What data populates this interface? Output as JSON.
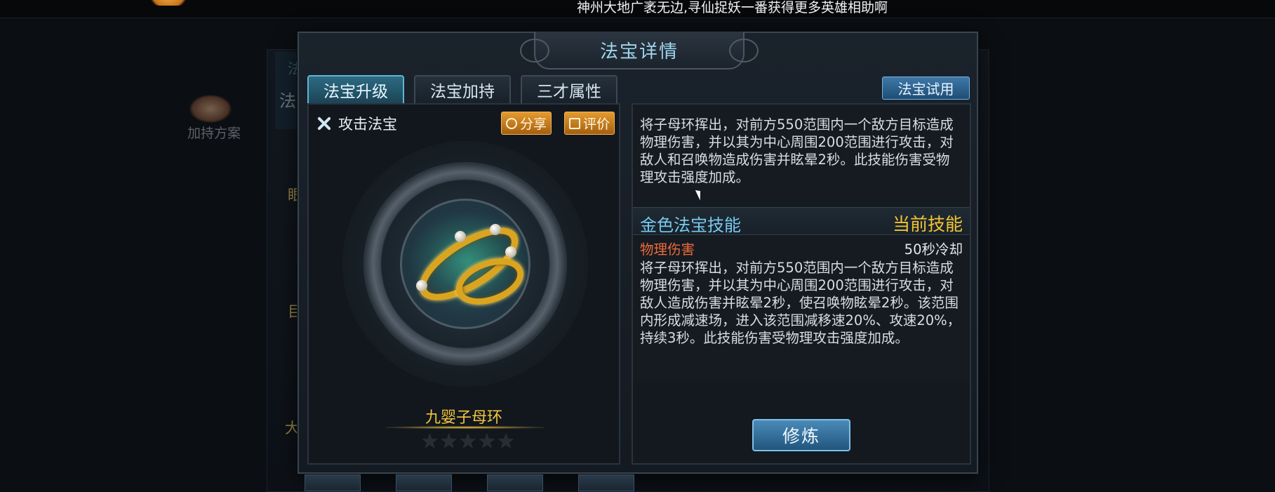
{
  "marquee": "神州大地广袤无边,寻仙捉妖一番获得更多英雄相助啊",
  "background": {
    "strip_tab1": "法",
    "strip_tab2": "法",
    "plan_label": "加持方案",
    "left_char_1": "眼",
    "left_char_2": "目",
    "left_char_3": "大"
  },
  "dialog": {
    "title": "法宝详情",
    "tabs": [
      {
        "label": "法宝升级",
        "active": true
      },
      {
        "label": "法宝加持",
        "active": false
      },
      {
        "label": "三才属性",
        "active": false
      }
    ],
    "try_button": "法宝试用"
  },
  "item": {
    "type": "攻击法宝",
    "share_label": "分享",
    "rate_label": "评价",
    "name": "九婴子母环",
    "stars_filled": 0,
    "stars_total": 5
  },
  "description": "将子母环挥出，对前方550范围内一个敌方目标造成物理伤害，并以其为中心周围200范围进行攻击，对敌人和召唤物造成伤害并眩晕2秒。此技能伤害受物理攻击强度加成。",
  "skill_section": {
    "left_title": "金色法宝技能",
    "right_title": "当前技能",
    "skill_name": "物理伤害",
    "cooldown": "50秒冷却",
    "skill_text": "将子母环挥出，对前方550范围内一个敌方目标造成物理伤害，并以其为中心周围200范围进行攻击，对敌人造成伤害并眩晕2秒，使召唤物眩晕2秒。该范围内形成减速场，进入该范围减移速20%、攻速20%，持续3秒。此技能伤害受物理攻击强度加成。"
  },
  "cultivate_button": "修炼",
  "colors": {
    "accent_blue": "#79c9f0",
    "gold": "#f4c432",
    "skill_red": "#ef6a3a",
    "orange_button": "#e49a2e"
  }
}
